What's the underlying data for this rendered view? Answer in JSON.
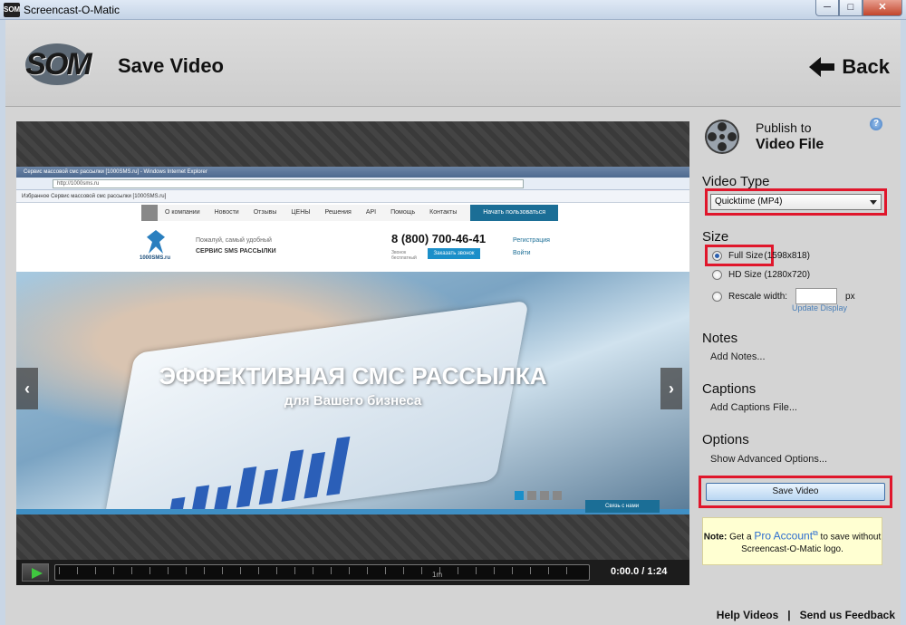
{
  "window": {
    "title": "Screencast-O-Matic",
    "app_icon_text": "SOM",
    "minimize": "─",
    "maximize": "□",
    "close": "✕"
  },
  "header": {
    "logo_text": "SOM",
    "page_title": "Save Video",
    "back_label": "Back"
  },
  "preview": {
    "browser_title": "Сервис массовой смс рассылки [1000SMS.ru] - Windows Internet Explorer",
    "address": "http://1000sms.ru",
    "favorites": "Избранное   Сервис массовой смс рассылки [1000SMS.ru]",
    "menu": [
      "О компании",
      "Новости",
      "Отзывы",
      "ЦЕНЫ",
      "Решения",
      "API",
      "Помощь",
      "Контакты"
    ],
    "start_btn": "Начать пользоваться",
    "site_logo": "1000SMS.ru",
    "tagline1": "Пожалуй, самый удобный",
    "tagline2": "СЕРВИС SMS РАССЫЛКИ",
    "phone": "8 (800) 700-46-41",
    "phone_note": "Звонок бесплатный",
    "call_btn": "Заказать звонок",
    "register": "Регистрация",
    "login": "Войти",
    "hero_title": "ЭФФЕКТИВНАЯ СМС РАССЫЛКА",
    "hero_subtitle": "для Вашего бизнеса",
    "chat_tab": "Связь с нами",
    "arrow_left": "‹",
    "arrow_right": "›"
  },
  "player": {
    "tick_label": "1m",
    "time_current": "0:00.0",
    "time_total": "1:24",
    "time_sep": " / "
  },
  "panel": {
    "publish_to": "Publish to",
    "publish_dest": "Video File",
    "help": "?",
    "video_type_label": "Video Type",
    "video_type_value": "Quicktime (MP4)",
    "size_label": "Size",
    "size_options": [
      {
        "label": "Full Size",
        "detail": "(1598x818)",
        "selected": true
      },
      {
        "label": "HD Size (1280x720)",
        "detail": "",
        "selected": false
      },
      {
        "label": "Rescale width:",
        "detail": "px",
        "selected": false
      }
    ],
    "update_display": "Update Display",
    "notes_label": "Notes",
    "add_notes": "Add Notes...",
    "captions_label": "Captions",
    "add_captions": "Add Captions File...",
    "options_label": "Options",
    "advanced_options": "Show Advanced Options...",
    "save_button": "Save Video",
    "note_prefix": "Note:",
    "note_get": " Get a ",
    "note_pro": "Pro Account",
    "note_ext": "⧉",
    "note_rest": " to save without Screencast-O-Matic logo."
  },
  "footer": {
    "help_videos": "Help Videos",
    "separator": "|",
    "feedback": "Send us Feedback"
  }
}
